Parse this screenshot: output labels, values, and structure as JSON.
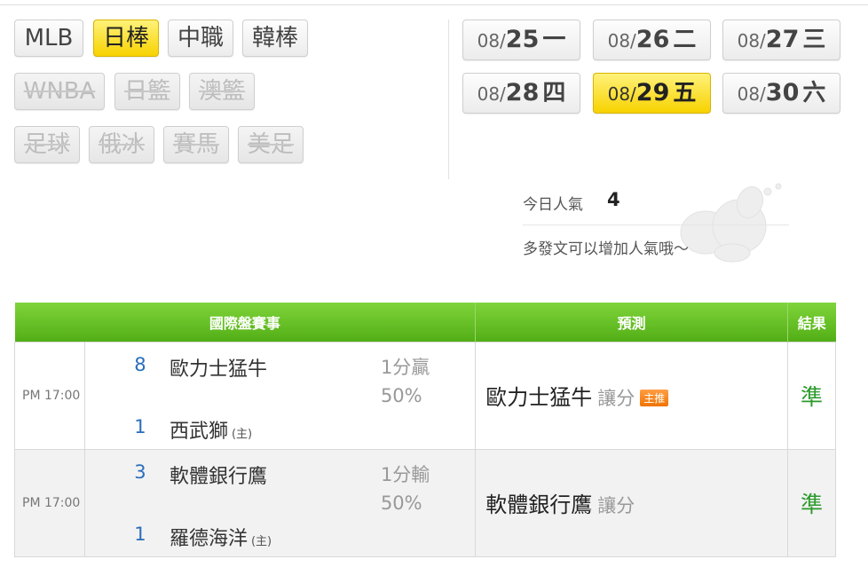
{
  "sports": [
    {
      "label": "MLB",
      "state": "normal"
    },
    {
      "label": "日棒",
      "state": "active"
    },
    {
      "label": "中職",
      "state": "normal"
    },
    {
      "label": "韓棒",
      "state": "normal"
    },
    {
      "label": "WNBA",
      "state": "disabled"
    },
    {
      "label": "日籃",
      "state": "disabled"
    },
    {
      "label": "澳籃",
      "state": "disabled"
    },
    {
      "label": "足球",
      "state": "disabled"
    },
    {
      "label": "俄冰",
      "state": "disabled"
    },
    {
      "label": "賽馬",
      "state": "disabled"
    },
    {
      "label": "美足",
      "state": "disabled"
    }
  ],
  "dates": [
    {
      "month": "08/",
      "day": "25",
      "weekday": "一",
      "active": false
    },
    {
      "month": "08/",
      "day": "26",
      "weekday": "二",
      "active": false
    },
    {
      "month": "08/",
      "day": "27",
      "weekday": "三",
      "active": false
    },
    {
      "month": "08/",
      "day": "28",
      "weekday": "四",
      "active": false
    },
    {
      "month": "08/",
      "day": "29",
      "weekday": "五",
      "active": true
    },
    {
      "month": "08/",
      "day": "30",
      "weekday": "六",
      "active": false
    }
  ],
  "popularity": {
    "label": "今日人氣",
    "value": "4",
    "tip": "多發文可以增加人氣哦～"
  },
  "table": {
    "headers": {
      "games": "國際盤賽事",
      "prediction": "預測",
      "result": "結果"
    },
    "rows": [
      {
        "time": "PM 17:00",
        "away_score": "8",
        "away_team": "歐力士猛牛",
        "home_score": "1",
        "home_team": "西武獅",
        "home_mark": "(主)",
        "line": "1分贏",
        "pct": "50%",
        "pick_team": "歐力士猛牛",
        "pick_kind": "讓分",
        "pick_badge": "主推",
        "result": "準"
      },
      {
        "time": "PM 17:00",
        "away_score": "3",
        "away_team": "軟體銀行鷹",
        "home_score": "1",
        "home_team": "羅德海洋",
        "home_mark": "(主)",
        "line": "1分輸",
        "pct": "50%",
        "pick_team": "軟體銀行鷹",
        "pick_kind": "讓分",
        "pick_badge": "",
        "result": "準"
      }
    ]
  },
  "colors": {
    "active_button": "#f7d200",
    "header_green": "#52ae16",
    "score_blue": "#2a6ebb",
    "result_green": "#2c9a2c",
    "badge_orange": "#f07400"
  }
}
